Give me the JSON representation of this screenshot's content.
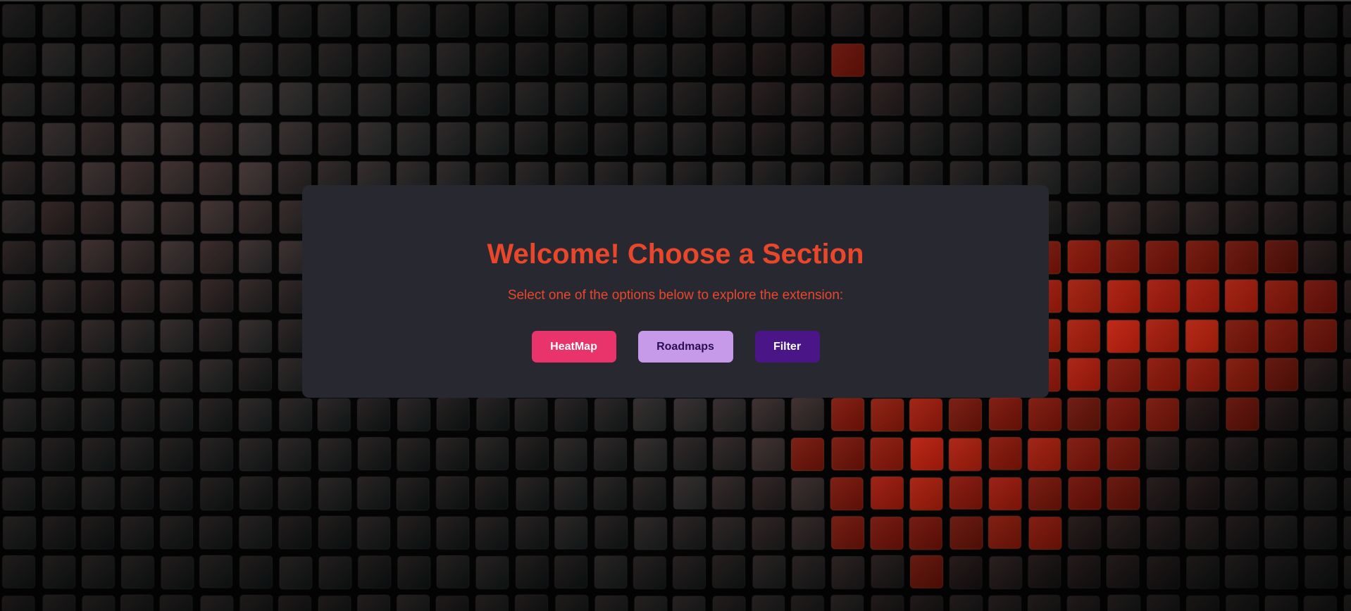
{
  "panel": {
    "title": "Welcome! Choose a Section",
    "subtitle": "Select one of the options below to explore the extension:"
  },
  "buttons": {
    "heatmap": "HeatMap",
    "roadmaps": "Roadmaps",
    "filter": "Filter"
  },
  "colors": {
    "accent": "#e8472c",
    "panel_bg": "#282831",
    "heatmap_bg": "#e8336b",
    "heatmap_text": "#ffffff",
    "roadmaps_bg": "#c79ae9",
    "roadmaps_text": "#2a0f52",
    "filter_bg": "#4a1587",
    "filter_text": "#ffffff"
  },
  "background": {
    "description_icon": "tile-grid-background"
  }
}
